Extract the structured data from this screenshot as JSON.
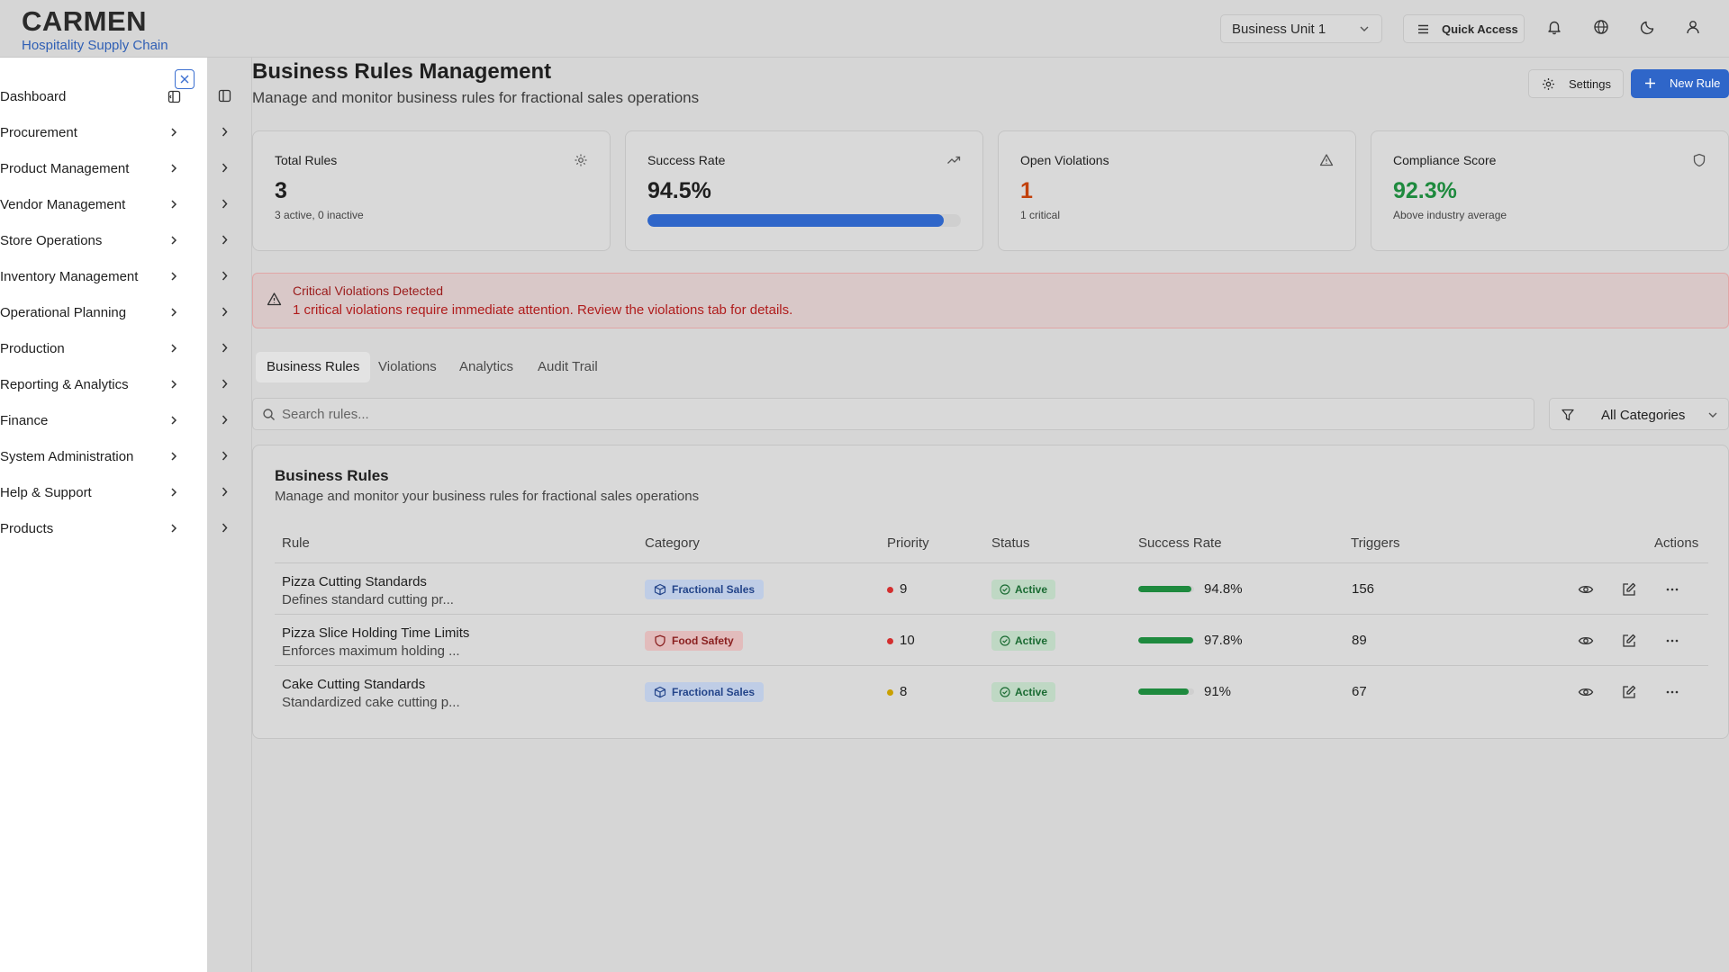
{
  "header": {
    "brand": "CARMEN",
    "brand_sub": "Hospitality Supply Chain",
    "business_unit": "Business Unit 1",
    "quick_access": "Quick Access"
  },
  "sidebar": {
    "items": [
      {
        "label": "Dashboard"
      },
      {
        "label": "Procurement"
      },
      {
        "label": "Product Management"
      },
      {
        "label": "Vendor Management"
      },
      {
        "label": "Store Operations"
      },
      {
        "label": "Inventory Management"
      },
      {
        "label": "Operational Planning"
      },
      {
        "label": "Production"
      },
      {
        "label": "Reporting & Analytics"
      },
      {
        "label": "Finance"
      },
      {
        "label": "System Administration"
      },
      {
        "label": "Help & Support"
      },
      {
        "label": "Products"
      }
    ]
  },
  "page": {
    "title": "Business Rules Management",
    "subtitle": "Manage and monitor business rules for fractional sales operations",
    "settings_label": "Settings",
    "new_rule_label": "New Rule"
  },
  "stats": {
    "total": {
      "title": "Total Rules",
      "value": "3",
      "note": "3 active, 0 inactive"
    },
    "success": {
      "title": "Success Rate",
      "value": "94.5%",
      "fraction": 0.945
    },
    "violations": {
      "title": "Open Violations",
      "value": "1",
      "note": "1 critical",
      "color": "#c2410c"
    },
    "compliance": {
      "title": "Compliance Score",
      "value": "92.3%",
      "note": "Above industry average",
      "color": "#1e8a3e"
    }
  },
  "alert": {
    "title": "Critical Violations Detected",
    "description": "1 critical violations require immediate attention. Review the violations tab for details."
  },
  "tabs": [
    {
      "label": "Business Rules",
      "active": true
    },
    {
      "label": "Violations"
    },
    {
      "label": "Analytics"
    },
    {
      "label": "Audit Trail"
    }
  ],
  "search": {
    "placeholder": "Search rules...",
    "category": "All Categories"
  },
  "table": {
    "title": "Business Rules",
    "subtitle": "Manage and monitor your business rules for fractional sales operations",
    "columns": [
      "Rule",
      "Category",
      "Priority",
      "Status",
      "Success Rate",
      "Triggers",
      "Actions"
    ],
    "rows": [
      {
        "name": "Pizza Cutting Standards",
        "desc": "Defines standard cutting pr...",
        "category": "Fractional Sales",
        "category_icon": "cube-icon",
        "priority": "9",
        "priority_color": "#d32f2f",
        "status": "Active",
        "success": "94.8%",
        "success_fraction": 0.948,
        "triggers": "156"
      },
      {
        "name": "Pizza Slice Holding Time Limits",
        "desc": "Enforces maximum holding ...",
        "category": "Food Safety",
        "category_icon": "shield-icon",
        "priority": "10",
        "priority_color": "#d32f2f",
        "status": "Active",
        "success": "97.8%",
        "success_fraction": 0.978,
        "triggers": "89"
      },
      {
        "name": "Cake Cutting Standards",
        "desc": "Standardized cake cutting p...",
        "category": "Fractional Sales",
        "category_icon": "cube-icon",
        "priority": "8",
        "priority_color": "#c9a000",
        "status": "Active",
        "success": "91%",
        "success_fraction": 0.91,
        "triggers": "67"
      }
    ]
  }
}
